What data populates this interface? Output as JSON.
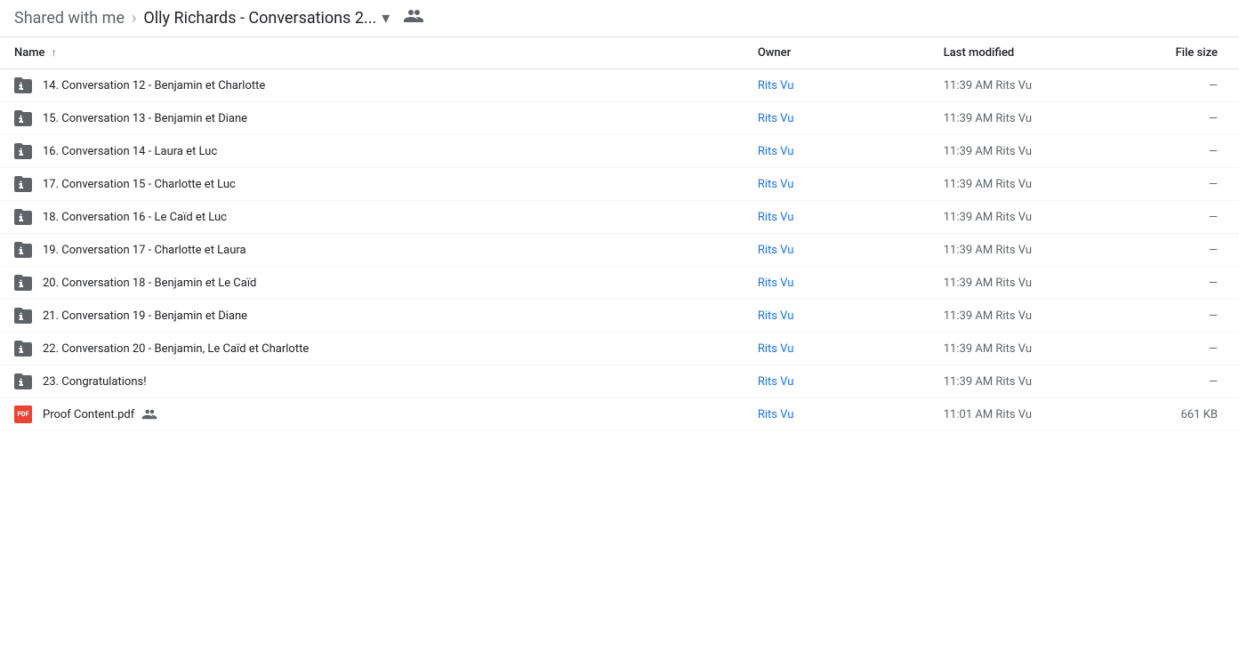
{
  "breadcrumb": {
    "shared_label": "Shared with me",
    "separator": ">",
    "current": "Olly Richards - Conversations 2...",
    "dropdown_icon": "▾",
    "people_icon": "👥"
  },
  "table": {
    "columns": {
      "name": "Name",
      "name_sort_icon": "↑",
      "owner": "Owner",
      "last_modified": "Last modified",
      "file_size": "File size"
    },
    "rows": [
      {
        "id": 14,
        "type": "folder-shared",
        "name": "14. Conversation 12 - Benjamin et Charlotte",
        "owner": "Rits Vu",
        "modified": "11:39 AM Rits Vu",
        "size": "—"
      },
      {
        "id": 15,
        "type": "folder-shared",
        "name": "15. Conversation 13 - Benjamin et Diane",
        "owner": "Rits Vu",
        "modified": "11:39 AM Rits Vu",
        "size": "—"
      },
      {
        "id": 16,
        "type": "folder-shared",
        "name": "16. Conversation 14 - Laura et Luc",
        "owner": "Rits Vu",
        "modified": "11:39 AM Rits Vu",
        "size": "—"
      },
      {
        "id": 17,
        "type": "folder-shared",
        "name": "17. Conversation 15 - Charlotte et Luc",
        "owner": "Rits Vu",
        "modified": "11:39 AM Rits Vu",
        "size": "—"
      },
      {
        "id": 18,
        "type": "folder-shared",
        "name": "18. Conversation 16 - Le Caïd et Luc",
        "owner": "Rits Vu",
        "modified": "11:39 AM Rits Vu",
        "size": "—"
      },
      {
        "id": 19,
        "type": "folder-shared",
        "name": "19. Conversation 17 - Charlotte et Laura",
        "owner": "Rits Vu",
        "modified": "11:39 AM Rits Vu",
        "size": "—"
      },
      {
        "id": 20,
        "type": "folder-shared",
        "name": "20. Conversation 18 - Benjamin et Le Caïd",
        "owner": "Rits Vu",
        "modified": "11:39 AM Rits Vu",
        "size": "—"
      },
      {
        "id": 21,
        "type": "folder-shared",
        "name": "21. Conversation 19 - Benjamin et Diane",
        "owner": "Rits Vu",
        "modified": "11:39 AM Rits Vu",
        "size": "—"
      },
      {
        "id": 22,
        "type": "folder-shared",
        "name": "22. Conversation 20 - Benjamin, Le Caïd et Charlotte",
        "owner": "Rits Vu",
        "modified": "11:39 AM Rits Vu",
        "size": "—"
      },
      {
        "id": 23,
        "type": "folder-shared",
        "name": "23. Congratulations!",
        "owner": "Rits Vu",
        "modified": "11:39 AM Rits Vu",
        "size": "—"
      },
      {
        "id": 24,
        "type": "pdf",
        "name": "Proof Content.pdf",
        "has_shared_icon": true,
        "owner": "Rits Vu",
        "modified": "11:01 AM Rits Vu",
        "size": "661 KB"
      }
    ]
  }
}
